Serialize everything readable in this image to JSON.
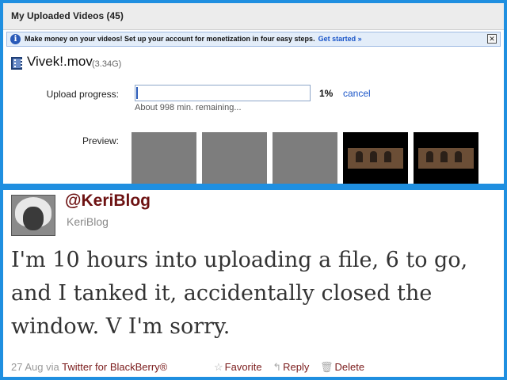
{
  "upload_panel": {
    "title": "My Uploaded Videos (45)",
    "banner": {
      "message": "Make money on your videos! Set up your account for monetization in four easy steps.",
      "link": "Get started »"
    },
    "file": {
      "name": "Vivek!.mov",
      "size": "(3.34G)"
    },
    "progress": {
      "label": "Upload progress:",
      "fraction": 0.01,
      "percent_text": "1%",
      "cancel_label": "cancel",
      "remaining": "About 998 min. remaining..."
    },
    "preview": {
      "label": "Preview:",
      "thumbnails": [
        "gray",
        "gray",
        "gray",
        "video-frame",
        "video-frame"
      ]
    }
  },
  "tweet": {
    "handle": "@KeriBlog",
    "username": "KeriBlog",
    "text": "I'm 10 hours into uploading a file, 6 to go, and I tanked it, accidentally closed the window. V I'm sorry.",
    "date": "27 Aug",
    "via": "via",
    "source": "Twitter for BlackBerry®",
    "actions": {
      "favorite": "Favorite",
      "reply": "Reply",
      "delete": "Delete"
    }
  },
  "colors": {
    "frame": "#1f8fe0",
    "link_blue": "#1a55c8",
    "handle_red": "#6d1212"
  }
}
